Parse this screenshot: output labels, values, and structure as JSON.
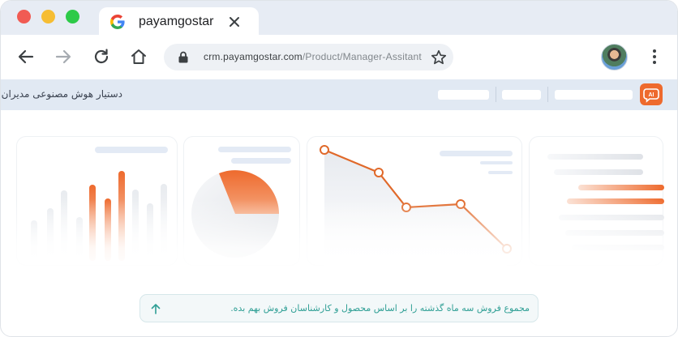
{
  "browser": {
    "tab_title": "payamgostar",
    "url_host": "crm.payamgostar.com",
    "url_path": "/Product/Manager-Assitant"
  },
  "app": {
    "title": "دستیار هوش مصنوعی مدیران",
    "ai_badge": "AI"
  },
  "prompt": {
    "text": "مجموع فروش سه ماه گذشته را بر اساس محصول و کارشناسان فروش بهم بده."
  },
  "colors": {
    "accent": "#ee6a2d",
    "tabbar": "#e7ecf4",
    "appbar": "#e1e9f3",
    "prompt_text": "#2f9f95"
  },
  "icons": {
    "favicon": "google-icon",
    "close": "close-icon",
    "back": "back-arrow-icon",
    "forward": "forward-arrow-icon",
    "reload": "reload-icon",
    "home": "home-icon",
    "lock": "lock-icon",
    "star": "star-icon",
    "menu": "kebab-menu-icon",
    "send": "send-arrow-icon"
  }
}
